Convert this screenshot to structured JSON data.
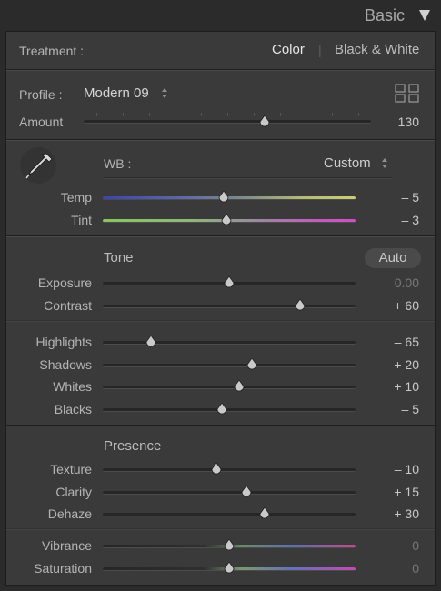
{
  "header": {
    "title": "Basic",
    "collapse_icon": "triangle-down-icon"
  },
  "treatment": {
    "label": "Treatment :",
    "color_label": "Color",
    "divider": "|",
    "bw_label": "Black & White"
  },
  "profile": {
    "label": "Profile :",
    "value": "Modern 09",
    "browser_icon": "grid-icon"
  },
  "amount": {
    "label": "Amount",
    "value": "130",
    "fraction": 0.63
  },
  "wb": {
    "label": "WB :",
    "value": "Custom",
    "picker_icon": "eyedropper-icon"
  },
  "sliders_wb": [
    {
      "label": "Temp",
      "value": "– 5",
      "fraction": 0.48
    },
    {
      "label": "Tint",
      "value": "– 3",
      "fraction": 0.49
    }
  ],
  "tone": {
    "title": "Tone",
    "auto_label": "Auto"
  },
  "sliders_tone1": [
    {
      "label": "Exposure",
      "value": "0.00",
      "fraction": 0.5
    },
    {
      "label": "Contrast",
      "value": "+ 60",
      "fraction": 0.78
    }
  ],
  "sliders_tone2": [
    {
      "label": "Highlights",
      "value": "– 65",
      "fraction": 0.19
    },
    {
      "label": "Shadows",
      "value": "+ 20",
      "fraction": 0.59
    },
    {
      "label": "Whites",
      "value": "+ 10",
      "fraction": 0.54
    },
    {
      "label": "Blacks",
      "value": "– 5",
      "fraction": 0.47
    }
  ],
  "presence": {
    "title": "Presence"
  },
  "sliders_presence": [
    {
      "label": "Texture",
      "value": "– 10",
      "fraction": 0.45
    },
    {
      "label": "Clarity",
      "value": "+ 15",
      "fraction": 0.57
    },
    {
      "label": "Dehaze",
      "value": "+ 30",
      "fraction": 0.64
    }
  ],
  "sliders_color": [
    {
      "label": "Vibrance",
      "value": "0",
      "fraction": 0.5
    },
    {
      "label": "Saturation",
      "value": "0",
      "fraction": 0.5
    }
  ],
  "colors": {
    "panel_bg": "#3a3a3a",
    "temp_blue": "#3f48b8",
    "temp_yellow": "#c8cf72",
    "tint_green": "#8fcf5c",
    "tint_magenta": "#cf4fc8"
  }
}
